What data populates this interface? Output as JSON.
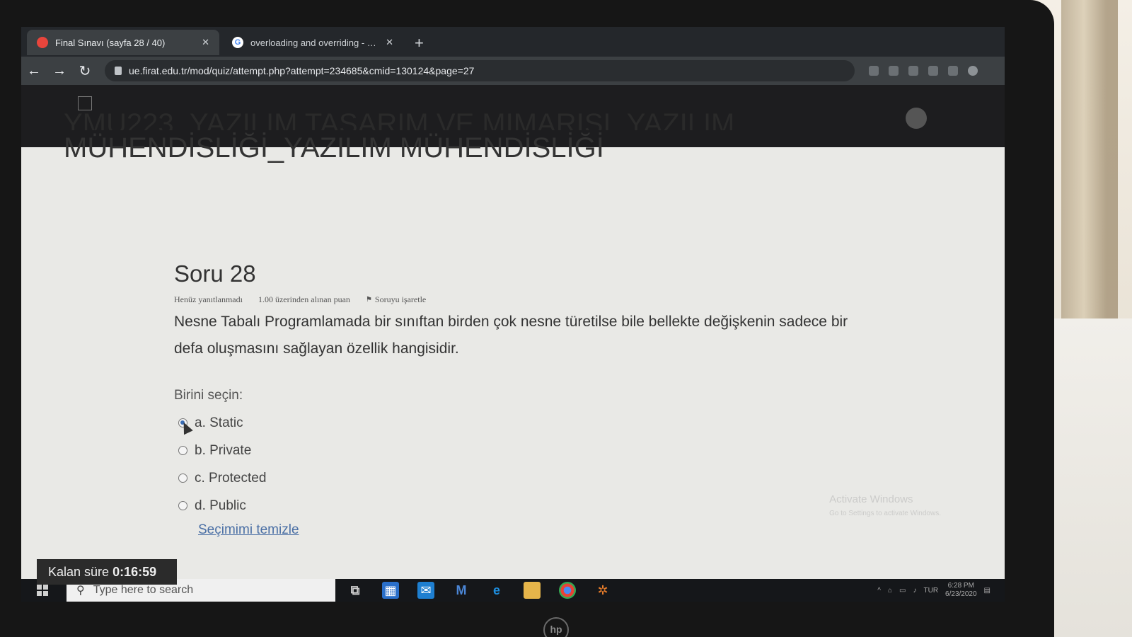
{
  "browser": {
    "tabs": [
      {
        "label": "Final Sınavı (sayfa 28 / 40)",
        "icon": "moodle-tab-icon",
        "active": true
      },
      {
        "label": "overloading and overriding - Go",
        "icon": "google-tab-icon",
        "active": false
      }
    ],
    "url": "ue.firat.edu.tr/mod/quiz/attempt.php?attempt=234685&cmid=130124&page=27"
  },
  "course": {
    "title_cut": "YMU223_YAZILIM TASARIM VE MİMARİSİ_YAZILIM",
    "title": "MÜHENDİSLİĞİ_YAZILIM MÜHENDİSLİĞİ"
  },
  "question": {
    "heading": "Soru 28",
    "status": "Henüz yanıtlanmadı",
    "points": "1.00 üzerinden alınan puan",
    "flag_label": "Soruyu işaretle",
    "text": "Nesne Tabalı Programlamada bir sınıftan birden çok nesne türetilse bile bellekte değişkenin sadece bir defa oluşmasını sağlayan özellik hangisidir.",
    "choose_label": "Birini seçin:",
    "answers": [
      {
        "label": "a. Static",
        "selected": true
      },
      {
        "label": "b. Private",
        "selected": false
      },
      {
        "label": "c. Protected",
        "selected": false
      },
      {
        "label": "d. Public",
        "selected": false
      }
    ],
    "clear_label": "Seçimimi temizle"
  },
  "timer": {
    "label": "Kalan süre",
    "value": "0:16:59"
  },
  "watermark": {
    "title": "Activate Windows",
    "subtitle": "Go to Settings to activate Windows."
  },
  "taskbar": {
    "search_placeholder": "Type here to search",
    "language": "TUR",
    "time": "6:28 PM",
    "date": "6/23/2020"
  }
}
